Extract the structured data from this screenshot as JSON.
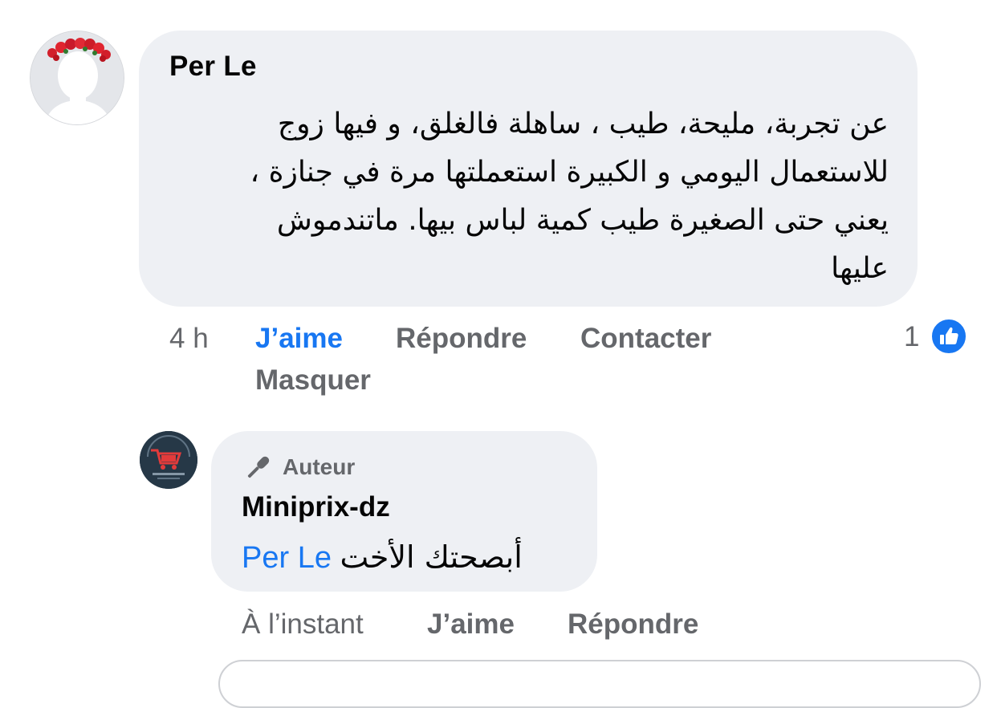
{
  "comment": {
    "author": "Per Le",
    "lines": [
      "عن تجربة، مليحة، طيب ، ساهلة فالغلق، و فيها زوج",
      "للاستعمال اليومي و الكبيرة استعملتها مرة في جنازة ،",
      "يعني حتى الصغيرة طيب كمية لباس بيها. ماتندموش",
      "عليها"
    ],
    "time": "4 h",
    "like_label": "J’aime",
    "reply_label": "Répondre",
    "contact_label": "Contacter",
    "hide_label": "Masquer",
    "reaction_count": "1"
  },
  "reply": {
    "badge_label": "Auteur",
    "author": "Miniprix-dz",
    "mention": "Per Le",
    "text": "أبصحتك الأخت",
    "time": "À l’instant",
    "like_label": "J’aime",
    "reply_label": "Répondre"
  },
  "colors": {
    "accent": "#1877f2",
    "bubble": "#eef0f4",
    "secondary_text": "#65676b"
  },
  "icons": {
    "reaction": "like-thumb-icon",
    "author_badge": "microphone-icon"
  }
}
